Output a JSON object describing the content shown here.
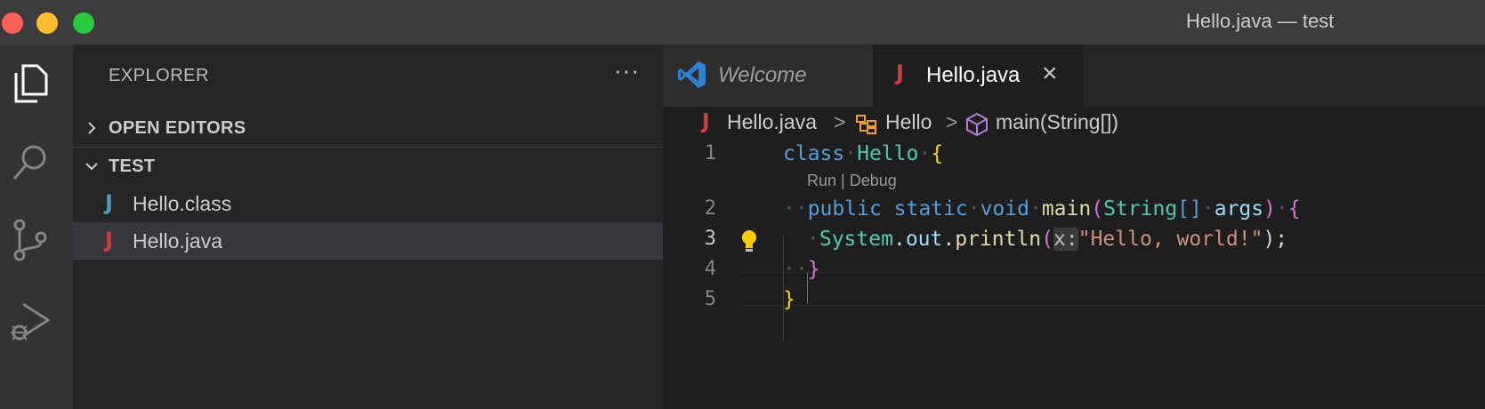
{
  "window": {
    "title": "Hello.java — test"
  },
  "activity_bar": {
    "items": [
      "explorer-icon",
      "search-icon",
      "source-control-icon",
      "run-debug-icon"
    ]
  },
  "sidebar": {
    "header": "EXPLORER",
    "more": "···",
    "sections": [
      {
        "label": "OPEN EDITORS",
        "expanded": false
      },
      {
        "label": "TEST",
        "expanded": true
      }
    ],
    "files": [
      {
        "name": "Hello.class",
        "icon": "J",
        "color": "#519aba"
      },
      {
        "name": "Hello.java",
        "icon": "J",
        "color": "#cc3e44",
        "selected": true
      }
    ]
  },
  "tabs": [
    {
      "label": "Welcome",
      "active": false
    },
    {
      "label": "Hello.java",
      "icon": "J",
      "active": true,
      "close": "×"
    }
  ],
  "breadcrumb": {
    "file": "Hello.java",
    "class": "Hello",
    "method": "main(String[])",
    "separator": ">"
  },
  "code": {
    "line_numbers": [
      "1",
      "2",
      "3",
      "4",
      "5"
    ],
    "codelens": "Run | Debug",
    "line1": {
      "kw": "class",
      "name": "Hello",
      "brace": "{"
    },
    "line2": {
      "mods": "public static",
      "type": "void",
      "fn": "main",
      "paren_open": "(",
      "ptype": "String",
      "brackets": "[]",
      "param": "args",
      "paren_close": ")",
      "brace": "{"
    },
    "line3": {
      "obj": "System",
      "field": "out",
      "fn": "println",
      "hint": "x:",
      "string": "\"Hello, world!\"",
      "end": ");"
    },
    "line4": {
      "brace": "}"
    },
    "line5": {
      "brace": "}"
    }
  },
  "colors": {
    "accent_blue": "#569cd6",
    "java_icon": "#cc3e44",
    "class_icon": "#519aba",
    "lightbulb": "#ffcc00"
  }
}
